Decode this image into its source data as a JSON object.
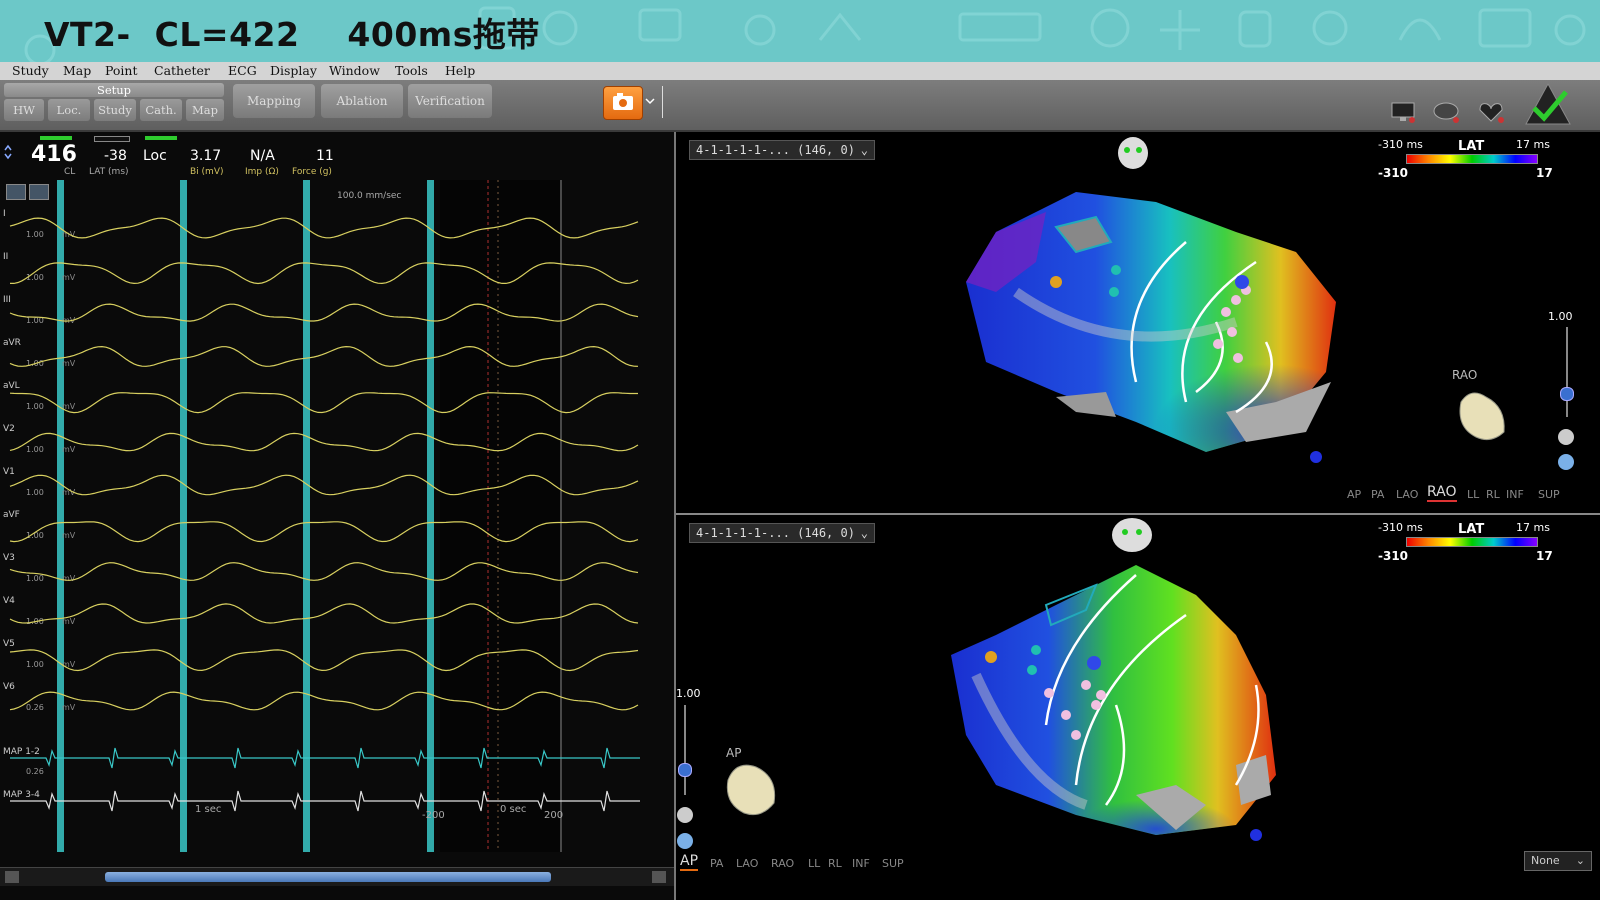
{
  "slide_title": "VT2-  CL=422    400ms拖带",
  "menu": [
    "Study",
    "Map",
    "Point",
    "Catheter",
    "ECG",
    "Display",
    "Window",
    "Tools",
    "Help"
  ],
  "toolbar": {
    "setup_label": "Setup",
    "setup_tabs": [
      "HW",
      "Loc.",
      "Study",
      "Cath.",
      "Map"
    ],
    "phase_buttons": [
      "Mapping",
      "Ablation",
      "Verification"
    ]
  },
  "readouts": {
    "cl_value": "416",
    "cl_label": "CL",
    "lat_value": "-38",
    "lat_label": "LAT (ms)",
    "loc": "Loc",
    "bi_value": "3.17",
    "bi_label": "Bi (mV)",
    "imp_value": "N/A",
    "imp_label": "Imp (Ω)",
    "force_value": "11",
    "force_label": "Force (g)"
  },
  "ecg": {
    "speed": "100.0 mm/sec",
    "leads": [
      "I",
      "II",
      "III",
      "aVR",
      "aVL",
      "V2",
      "V1",
      "aVF",
      "V3",
      "V4",
      "V5",
      "V6"
    ],
    "gain_labels": [
      "1.00",
      "1.00",
      "1.00",
      "1.00",
      "1.00",
      "1.00",
      "1.00",
      "1.00",
      "1.00",
      "1.00",
      "1.00",
      "0.26"
    ],
    "map_leads": [
      "MAP 1-2",
      "MAP 3-4"
    ],
    "map_gain": "0.26",
    "unit": "mV",
    "time_labels": {
      "one_sec": "1 sec",
      "neg200": "-200",
      "zero": "0 sec",
      "pos200": "200"
    }
  },
  "map_top": {
    "dropdown": "4-1-1-1-1-...  (146, 0)",
    "lat_min_label": "-310 ms",
    "lat_title": "LAT",
    "lat_max_label": "17 ms",
    "lat_min": "-310",
    "lat_max": "17",
    "zoom": "1.00",
    "orientation": "RAO",
    "views": [
      "AP",
      "PA",
      "LAO",
      "RAO",
      "LL",
      "RL",
      "INF",
      "SUP"
    ],
    "active_view": "RAO"
  },
  "map_bottom": {
    "dropdown": "4-1-1-1-1-...  (146, 0)",
    "lat_min_label": "-310 ms",
    "lat_title": "LAT",
    "lat_max_label": "17 ms",
    "lat_min": "-310",
    "lat_max": "17",
    "zoom": "1.00",
    "orientation": "AP",
    "views": [
      "AP",
      "PA",
      "LAO",
      "RAO",
      "LL",
      "RL",
      "INF",
      "SUP"
    ],
    "active_view": "AP",
    "select_value": "None"
  },
  "colors": {
    "banner": "#6cc8c8",
    "ecg_trace": "#d8d060",
    "map_trace": "#39c8c8",
    "accent": "#e46a10"
  }
}
